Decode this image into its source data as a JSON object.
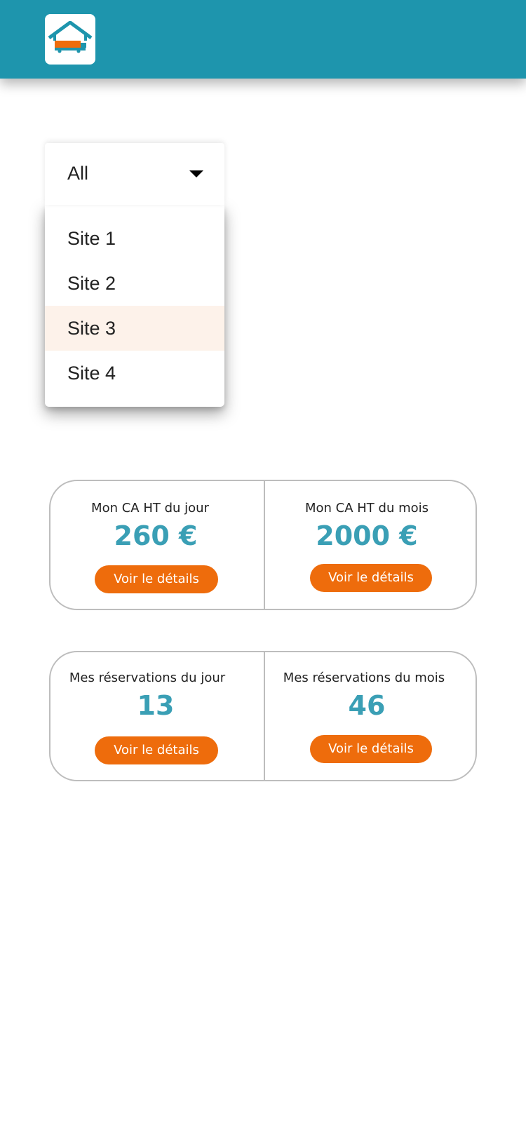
{
  "header": {
    "logo_icon": "warehouse-truck-logo-icon"
  },
  "filter": {
    "selected": "All",
    "options": [
      {
        "label": "Site 1"
      },
      {
        "label": "Site 2"
      },
      {
        "label": "Site 3",
        "highlighted": true
      },
      {
        "label": "Site 4"
      }
    ]
  },
  "revenue": {
    "day": {
      "label": "Mon CA HT du jour",
      "value": "260 €",
      "button": "Voir le détails"
    },
    "month": {
      "label": "Mon CA HT du mois",
      "value": "2000 €",
      "button": "Voir le détails"
    }
  },
  "reservations": {
    "day": {
      "label": "Mes réservations du jour",
      "value": "13",
      "button": "Voir le détails"
    },
    "month": {
      "label": "Mes réservations du mois",
      "value": "46",
      "button": "Voir le détails"
    }
  },
  "colors": {
    "header": "#1e95ad",
    "accent": "#ee6c0c",
    "value": "#3a9fb5",
    "highlight": "#fdf2ea"
  }
}
